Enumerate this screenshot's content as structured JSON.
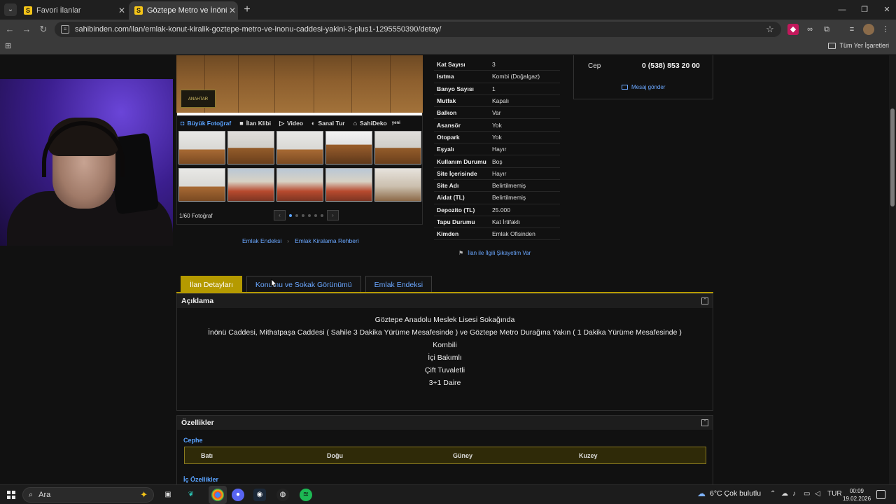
{
  "browser": {
    "tabs": [
      {
        "label": "Favori İlanlar",
        "favicon": "S"
      },
      {
        "label": "Göztepe Metro ve İnönü Cadde",
        "favicon": "S"
      }
    ],
    "new_tab": "+",
    "url": "sahibinden.com/ilan/emlak-konut-kiralik-goztepe-metro-ve-inonu-caddesi-yakini-3-plus1-1295550390/detay/",
    "bookmarks_all": "Tüm Yer İşaretleri"
  },
  "listing": {
    "media_tabs": [
      {
        "label": "Büyük Fotoğraf",
        "icon": "camera-icon"
      },
      {
        "label": "İlan Klibi",
        "icon": "video-camera-icon"
      },
      {
        "label": "Video",
        "icon": "play-icon"
      },
      {
        "label": "Sanal Tur",
        "icon": "vr-icon"
      },
      {
        "label": "SahiDeko",
        "icon": "home-icon",
        "badge": "yeni"
      }
    ],
    "logo_text": "ANAHTAR",
    "photo_count": "1/60 Fotoğraf",
    "sub_links": [
      "Emlak Endeksi",
      "Emlak Kiralama Rehberi"
    ],
    "attributes": [
      {
        "key": "Kat Sayısı",
        "value": "3"
      },
      {
        "key": "Isıtma",
        "value": "Kombi (Doğalgaz)"
      },
      {
        "key": "Banyo Sayısı",
        "value": "1"
      },
      {
        "key": "Mutfak",
        "value": "Kapalı"
      },
      {
        "key": "Balkon",
        "value": "Var"
      },
      {
        "key": "Asansör",
        "value": "Yok"
      },
      {
        "key": "Otopark",
        "value": "Yok"
      },
      {
        "key": "Eşyalı",
        "value": "Hayır"
      },
      {
        "key": "Kullanım Durumu",
        "value": "Boş"
      },
      {
        "key": "Site İçerisinde",
        "value": "Hayır"
      },
      {
        "key": "Site Adı",
        "value": "Belirtilmemiş"
      },
      {
        "key": "Aidat (TL)",
        "value": "Belirtilmemiş"
      },
      {
        "key": "Depozito (TL)",
        "value": "25.000"
      },
      {
        "key": "Tapu Durumu",
        "value": "Kat İrtifaklı"
      },
      {
        "key": "Kimden",
        "value": "Emlak Ofisinden"
      }
    ],
    "complaint": "İlan ile İlgili Şikayetim Var",
    "contact": {
      "cep_label": "Cep",
      "phone": "0 (538) 853 20 00",
      "message": "Mesaj gönder"
    }
  },
  "detail_tabs": [
    "İlan Detayları",
    "Konumu ve Sokak Görünümü",
    "Emlak Endeksi"
  ],
  "description": {
    "title": "Açıklama",
    "lines": [
      "Göztepe Anadolu Meslek Lisesi Sokağında",
      "İnönü Caddesi, Mithatpaşa Caddesi ( Sahile 3 Dakika Yürüme Mesafesinde )  ve Göztepe Metro Durağına Yakın ( 1 Dakika Yürüme Mesafesinde )",
      "Kombili",
      "İçi Bakımlı",
      "Çift Tuvaletli",
      "3+1 Daire"
    ]
  },
  "features": {
    "title": "Özellikler",
    "facade_label": "Cephe",
    "facade_values": [
      "Batı",
      "Doğu",
      "Güney",
      "Kuzey"
    ],
    "next_group": "İç Özellikler"
  },
  "taskbar": {
    "search_placeholder": "Ara",
    "weather": "6°C  Çok bulutlu",
    "language": "TUR",
    "time": "00:09",
    "date": "19.02.2026"
  },
  "colors": {
    "accent": "#b59a00",
    "link": "#6aa7ff",
    "page_bg": "#111111"
  }
}
